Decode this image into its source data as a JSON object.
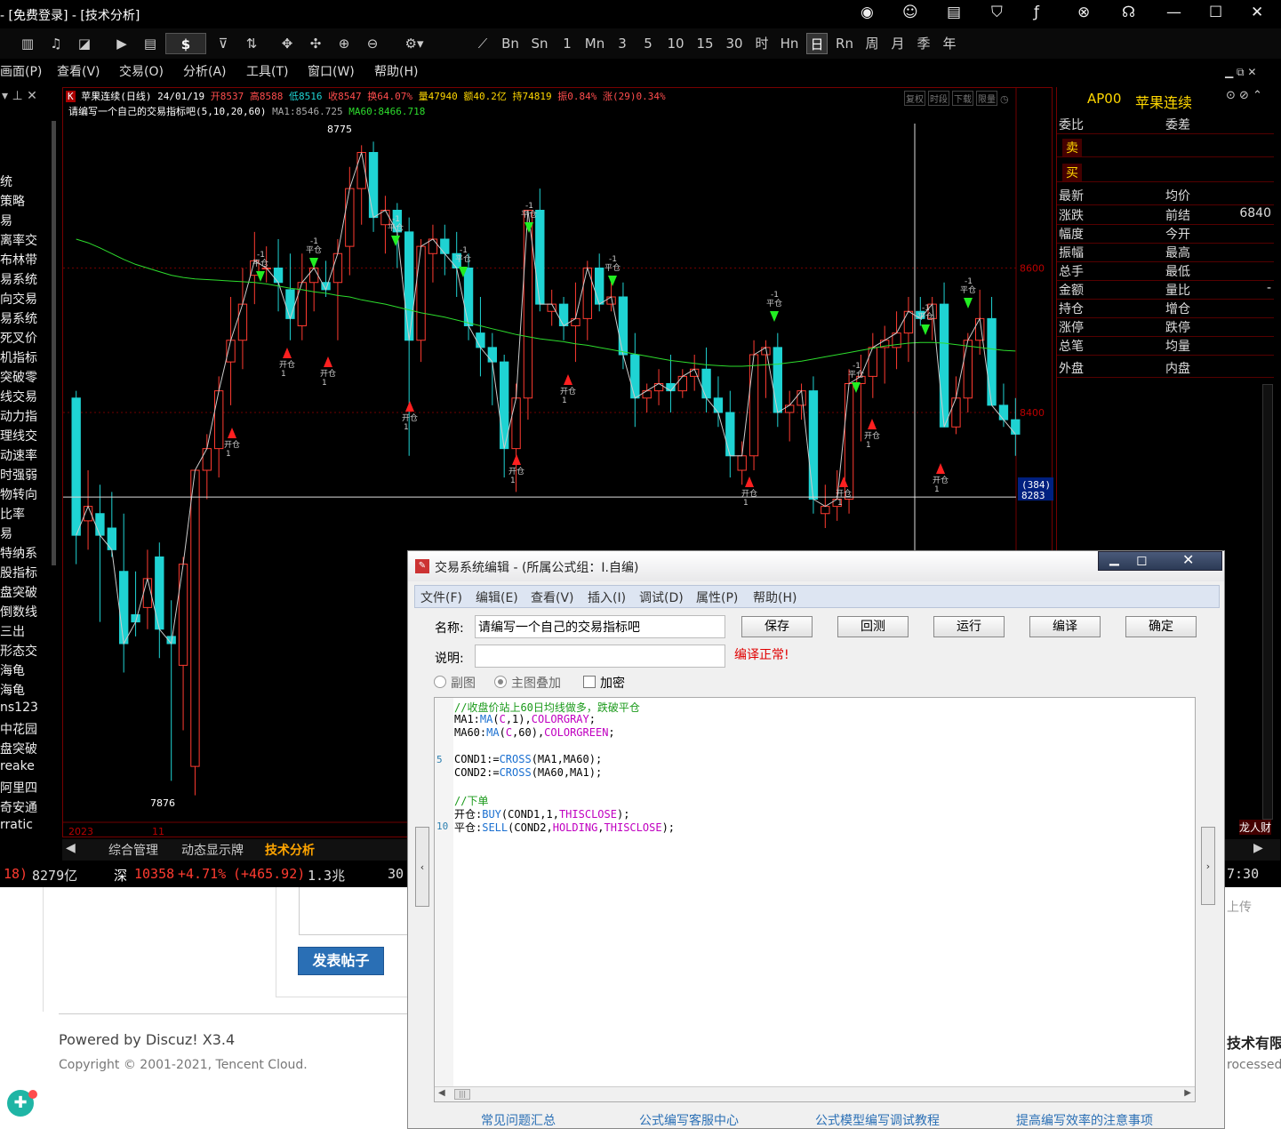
{
  "window": {
    "title": "- [免费登录] - [技术分析]"
  },
  "toolbar": {
    "periods": [
      "Bn",
      "Sn",
      "1",
      "Mn",
      "3",
      "5",
      "10",
      "15",
      "30",
      "时",
      "Hn",
      "日",
      "Rn",
      "周",
      "月",
      "季",
      "年"
    ],
    "selected_period": "日",
    "currency": "$"
  },
  "menu": [
    "画面(P)",
    "查看(V)",
    "交易(O)",
    "分析(A)",
    "工具(T)",
    "窗口(W)",
    "帮助(H)"
  ],
  "left_panel": {
    "items": [
      "统",
      "策略",
      "易",
      "离率交",
      "布林带",
      "易系统",
      "向交易",
      "易系统",
      "死叉价",
      "机指标",
      "突破零",
      "线交易",
      "动力指",
      "理线交",
      "动速率",
      "时强弱",
      "物转向",
      "比率",
      "易",
      "特纳系",
      "股指标",
      "盘突破",
      "倒数线",
      "三出",
      "形态交",
      "海龟",
      "海龟",
      "ns123",
      "中花园",
      "盘突破",
      "reake",
      "阿里四",
      "奇安通",
      "rratic"
    ]
  },
  "chart": {
    "symbol_line": {
      "symbol": "苹果连续(日线)",
      "date": "24/01/19",
      "open": "开8537",
      "high": "高8588",
      "low": "低8516",
      "close": "收8547",
      "turnover": "换64.07%",
      "volume": "量47940",
      "amount": "额40.2亿",
      "hold": "持74819",
      "amplitude": "振0.84%",
      "change": "涨(29)0.34%"
    },
    "indicator_line": {
      "name": "请编写一个自己的交易指标吧(5,10,20,60)",
      "ma1": "MA1:8546.725",
      "ma60": "MA60:8466.718"
    },
    "buttons": [
      "复权",
      "时段",
      "下载",
      "限量"
    ],
    "price_labels": [
      "8600",
      "8400"
    ],
    "cursor": {
      "count": "(384)",
      "price": "8283"
    },
    "extremes": {
      "high": "8775",
      "low": "7876"
    },
    "x_labels": [
      "2023",
      "11"
    ],
    "signals": {
      "close": "平仓",
      "open": "开仓",
      "minus_one": "-1",
      "one": "1"
    },
    "colors": {
      "up": "#ff3b30",
      "down": "#1fd3d3",
      "ma60": "#2ddc2d",
      "ma1": "#cccccc",
      "grid": "#700000"
    }
  },
  "chart_data": {
    "type": "candlestick",
    "title": "苹果连续(日线)",
    "ylim": [
      7840,
      8800
    ],
    "candles": [
      [
        8420,
        8430,
        8190,
        8230
      ],
      [
        8250,
        8320,
        8210,
        8270
      ],
      [
        8260,
        8300,
        8110,
        8230
      ],
      [
        8240,
        8290,
        8200,
        8210
      ],
      [
        8180,
        8260,
        8040,
        8080
      ],
      [
        8120,
        8180,
        8090,
        8110
      ],
      [
        8130,
        8210,
        8100,
        8170
      ],
      [
        8200,
        8220,
        8060,
        8100
      ],
      [
        8090,
        8140,
        7890,
        8080
      ],
      [
        8050,
        8200,
        7960,
        8190
      ],
      [
        7910,
        8310,
        7870,
        8320
      ],
      [
        8320,
        8370,
        8280,
        8350
      ],
      [
        8350,
        8450,
        8310,
        8430
      ],
      [
        8470,
        8560,
        8410,
        8500
      ],
      [
        8500,
        8600,
        8460,
        8550
      ],
      [
        8590,
        8650,
        8550,
        8610
      ],
      [
        8600,
        8630,
        8580,
        8600
      ],
      [
        8600,
        8640,
        8540,
        8580
      ],
      [
        8570,
        8620,
        8500,
        8530
      ],
      [
        8520,
        8620,
        8500,
        8580
      ],
      [
        8580,
        8610,
        8540,
        8600
      ],
      [
        8580,
        8610,
        8560,
        8570
      ],
      [
        8580,
        8640,
        8500,
        8620
      ],
      [
        8630,
        8740,
        8590,
        8710
      ],
      [
        8710,
        8770,
        8660,
        8760
      ],
      [
        8760,
        8775,
        8650,
        8670
      ],
      [
        8660,
        8700,
        8620,
        8680
      ],
      [
        8680,
        8690,
        8600,
        8650
      ],
      [
        8650,
        8670,
        8340,
        8500
      ],
      [
        8500,
        8640,
        8470,
        8630
      ],
      [
        8620,
        8660,
        8580,
        8640
      ],
      [
        8640,
        8660,
        8590,
        8620
      ],
      [
        8620,
        8650,
        8560,
        8600
      ],
      [
        8600,
        8620,
        8500,
        8520
      ],
      [
        8510,
        8560,
        8450,
        8490
      ],
      [
        8490,
        8510,
        8410,
        8470
      ],
      [
        8470,
        8480,
        8310,
        8350
      ],
      [
        8350,
        8440,
        8290,
        8420
      ],
      [
        8420,
        8680,
        8390,
        8680
      ],
      [
        8680,
        8710,
        8540,
        8550
      ],
      [
        8540,
        8570,
        8520,
        8550
      ],
      [
        8550,
        8560,
        8500,
        8520
      ],
      [
        8520,
        8580,
        8470,
        8530
      ],
      [
        8530,
        8610,
        8500,
        8600
      ],
      [
        8600,
        8620,
        8540,
        8550
      ],
      [
        8550,
        8580,
        8540,
        8560
      ],
      [
        8560,
        8580,
        8460,
        8480
      ],
      [
        8480,
        8510,
        8380,
        8420
      ],
      [
        8420,
        8440,
        8400,
        8430
      ],
      [
        8430,
        8460,
        8410,
        8440
      ],
      [
        8440,
        8480,
        8400,
        8430
      ],
      [
        8430,
        8460,
        8420,
        8450
      ],
      [
        8450,
        8480,
        8430,
        8460
      ],
      [
        8460,
        8490,
        8400,
        8420
      ],
      [
        8420,
        8450,
        8380,
        8400
      ],
      [
        8400,
        8430,
        8310,
        8340
      ],
      [
        8320,
        8360,
        8300,
        8340
      ],
      [
        8340,
        8500,
        8320,
        8480
      ],
      [
        8480,
        8500,
        8420,
        8490
      ],
      [
        8490,
        8510,
        8380,
        8400
      ],
      [
        8400,
        8430,
        8360,
        8410
      ],
      [
        8410,
        8440,
        8390,
        8430
      ],
      [
        8430,
        8450,
        8260,
        8280
      ],
      [
        8260,
        8300,
        8240,
        8270
      ],
      [
        8270,
        8320,
        8250,
        8280
      ],
      [
        8280,
        8460,
        8260,
        8440
      ],
      [
        8440,
        8480,
        8360,
        8450
      ],
      [
        8450,
        8510,
        8420,
        8490
      ],
      [
        8490,
        8520,
        8440,
        8500
      ],
      [
        8490,
        8540,
        8460,
        8510
      ],
      [
        8510,
        8560,
        8470,
        8540
      ],
      [
        8540,
        8560,
        8520,
        8530
      ],
      [
        8530,
        8560,
        8500,
        8550
      ],
      [
        8550,
        8580,
        8470,
        8380
      ],
      [
        8380,
        8450,
        8370,
        8420
      ],
      [
        8420,
        8510,
        8400,
        8500
      ],
      [
        8500,
        8570,
        8480,
        8530
      ],
      [
        8530,
        8560,
        8410,
        8410
      ],
      [
        8410,
        8440,
        8380,
        8390
      ],
      [
        8390,
        8420,
        8340,
        8370
      ]
    ],
    "ma60": [
      8640,
      8635,
      8628,
      8620,
      8612,
      8605,
      8600,
      8595,
      8590,
      8587,
      8585,
      8584,
      8583,
      8582,
      8581,
      8580,
      8578,
      8575,
      8572,
      8570,
      8567,
      8565,
      8562,
      8560,
      8556,
      8553,
      8550,
      8546,
      8542,
      8538,
      8535,
      8532,
      8528,
      8524,
      8520,
      8516,
      8512,
      8508,
      8505,
      8502,
      8500,
      8498,
      8495,
      8493,
      8490,
      8487,
      8484,
      8481,
      8478,
      8475,
      8472,
      8470,
      8468,
      8466,
      8465,
      8464,
      8464,
      8465,
      8466,
      8467,
      8469,
      8471,
      8474,
      8477,
      8480,
      8483,
      8486,
      8489,
      8492,
      8494,
      8496,
      8497,
      8497,
      8496,
      8494,
      8492,
      8490,
      8488,
      8486,
      8485
    ]
  },
  "quote_panel": {
    "header": {
      "code": "AP00",
      "name": "苹果连续"
    },
    "rows": [
      {
        "l": "委比",
        "r": "委差",
        "v": ""
      },
      {
        "l": "卖",
        "r": "",
        "v": ""
      },
      {
        "l": "买",
        "r": "",
        "v": ""
      },
      {
        "l": "最新",
        "r": "均价",
        "v": ""
      },
      {
        "l": "涨跌",
        "r": "前结",
        "v": "6840"
      },
      {
        "l": "幅度",
        "r": "今开",
        "v": ""
      },
      {
        "l": "振幅",
        "r": "最高",
        "v": ""
      },
      {
        "l": "总手",
        "r": "最低",
        "v": ""
      },
      {
        "l": "金额",
        "r": "量比",
        "v": "-"
      },
      {
        "l": "持仓",
        "r": "增仓",
        "v": ""
      },
      {
        "l": "涨停",
        "r": "跌停",
        "v": ""
      },
      {
        "l": "总笔",
        "r": "均量",
        "v": ""
      },
      {
        "l": "外盘",
        "r": "内盘",
        "v": ""
      }
    ],
    "corner": "龙人财"
  },
  "tabs": [
    "综合管理",
    "动态显示牌",
    "技术分析"
  ],
  "status": {
    "a": "18)",
    "b": "8279亿",
    "c": "深",
    "d": "10358",
    "e": "+4.71%",
    "f": "(+465.92)",
    "g": "1.3兆",
    "h": "30",
    "time": "7:30"
  },
  "web": {
    "post_button": "发表帖子",
    "powered": "Powered by Discuz! X3.4",
    "copyright": "Copyright © 2001-2021, Tencent Cloud.",
    "upload": "上传",
    "company": "技术有限",
    "processed": "rocessed"
  },
  "dialog": {
    "title": "交易系统编辑 - (所属公式组：I.自编)",
    "menu": [
      "文件(F)",
      "编辑(E)",
      "查看(V)",
      "插入(I)",
      "调试(D)",
      "属性(P)",
      "帮助(H)"
    ],
    "name_label": "名称:",
    "name_value": "请编写一个自己的交易指标吧",
    "desc_label": "说明:",
    "desc_value": "",
    "buttons": [
      "保存",
      "回测",
      "运行",
      "编译",
      "确定"
    ],
    "compile_status": "编译正常!",
    "options": {
      "sub": "副图",
      "main": "主图叠加",
      "encrypt": "加密"
    },
    "code": [
      {
        "n": "",
        "t": "//收盘价站上60日均线做多，跌破平仓"
      },
      {
        "n": "",
        "t": "MA1:MA(C,1),COLORGRAY;"
      },
      {
        "n": "",
        "t": "MA60:MA(C,60),COLORGREEN;"
      },
      {
        "n": "",
        "t": ""
      },
      {
        "n": "5",
        "t": "COND1:=CROSS(MA1,MA60);"
      },
      {
        "n": "",
        "t": "COND2:=CROSS(MA60,MA1);"
      },
      {
        "n": "",
        "t": ""
      },
      {
        "n": "",
        "t": "//下单"
      },
      {
        "n": "",
        "t": "开仓:BUY(COND1,1,THISCLOSE);"
      },
      {
        "n": "10",
        "t": "平仓:SELL(COND2,HOLDING,THISCLOSE);"
      }
    ],
    "links": [
      "常见问题汇总",
      "公式编写客服中心",
      "公式模型编写调试教程",
      "提高编写效率的注意事项"
    ]
  }
}
